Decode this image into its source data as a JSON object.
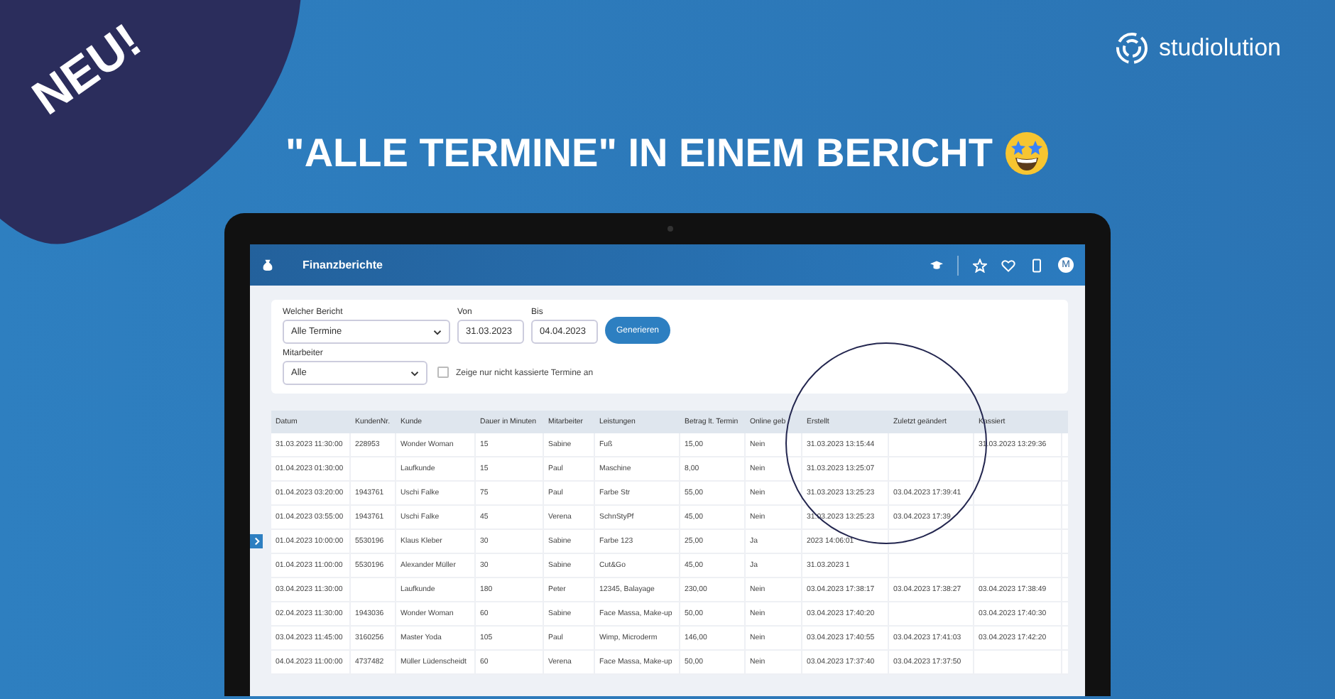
{
  "badge": "NEU!",
  "brand": "studiolution",
  "headline": "\"ALLE TERMINE\" IN EINEM BERICHT",
  "app": {
    "title": "Finanzberichte",
    "avatar": "M",
    "filters": {
      "report": {
        "label": "Welcher Bericht",
        "value": "Alle Termine"
      },
      "from": {
        "label": "Von",
        "value": "31.03.2023"
      },
      "to": {
        "label": "Bis",
        "value": "04.04.2023"
      },
      "button": "Generieren",
      "staff": {
        "label": "Mitarbeiter",
        "value": "Alle"
      },
      "only_unpaid": {
        "label": "Zeige nur nicht kassierte Termine an",
        "checked": false
      }
    },
    "table": {
      "columns": [
        "Datum",
        "KundenNr.",
        "Kunde",
        "Dauer in Minuten",
        "Mitarbeiter",
        "Leistungen",
        "Betrag lt. Termin",
        "Online geb",
        "Erstellt",
        "Zuletzt geändert",
        "Kassiert"
      ],
      "rows": [
        [
          "31.03.2023 11:30:00",
          "228953",
          "Wonder Woman",
          "15",
          "Sabine",
          "Fuß",
          "15,00",
          "Nein",
          "31.03.2023 13:15:44",
          null,
          "31.03.2023 13:29:36"
        ],
        [
          "01.04.2023 01:30:00",
          null,
          "Laufkunde",
          "15",
          "Paul",
          "Maschine",
          "8,00",
          "Nein",
          "31.03.2023 13:25:07",
          null,
          null
        ],
        [
          "01.04.2023 03:20:00",
          "1943761",
          "Uschi Falke",
          "75",
          "Paul",
          "Farbe Str",
          "55,00",
          "Nein",
          "31.03.2023 13:25:23",
          "03.04.2023 17:39:41",
          null
        ],
        [
          "01.04.2023 03:55:00",
          "1943761",
          "Uschi Falke",
          "45",
          "Verena",
          "SchnStyPf",
          "45,00",
          "Nein",
          "31.03.2023 13:25:23",
          "03.04.2023 17:39",
          null
        ],
        [
          "01.04.2023 10:00:00",
          "5530196",
          "Klaus Kleber",
          "30",
          "Sabine",
          "Farbe 123",
          "25,00",
          "Ja",
          "2023 14:06:01",
          null,
          null
        ],
        [
          "01.04.2023 11:00:00",
          "5530196",
          "Alexander Müller",
          "30",
          "Sabine",
          "Cut&Go",
          "45,00",
          "Ja",
          "31.03.2023 1",
          null,
          null
        ],
        [
          "03.04.2023 11:30:00",
          null,
          "Laufkunde",
          "180",
          "Peter",
          "12345, Balayage",
          "230,00",
          "Nein",
          "03.04.2023 17:38:17",
          "03.04.2023 17:38:27",
          "03.04.2023 17:38:49"
        ],
        [
          "02.04.2023 11:30:00",
          "1943036",
          "Wonder Woman",
          "60",
          "Sabine",
          "Face Massa, Make-up",
          "50,00",
          "Nein",
          "03.04.2023 17:40:20",
          null,
          "03.04.2023 17:40:30"
        ],
        [
          "03.04.2023 11:45:00",
          "3160256",
          "Master Yoda",
          "105",
          "Paul",
          "Wimp, Microderm",
          "146,00",
          "Nein",
          "03.04.2023 17:40:55",
          "03.04.2023 17:41:03",
          "03.04.2023 17:42:20"
        ],
        [
          "04.04.2023 11:00:00",
          "4737482",
          "Müller Lüdenscheidt",
          "60",
          "Verena",
          "Face Massa, Make-up",
          "50,00",
          "Nein",
          "03.04.2023 17:37:40",
          "03.04.2023 17:37:50",
          null
        ]
      ]
    }
  }
}
